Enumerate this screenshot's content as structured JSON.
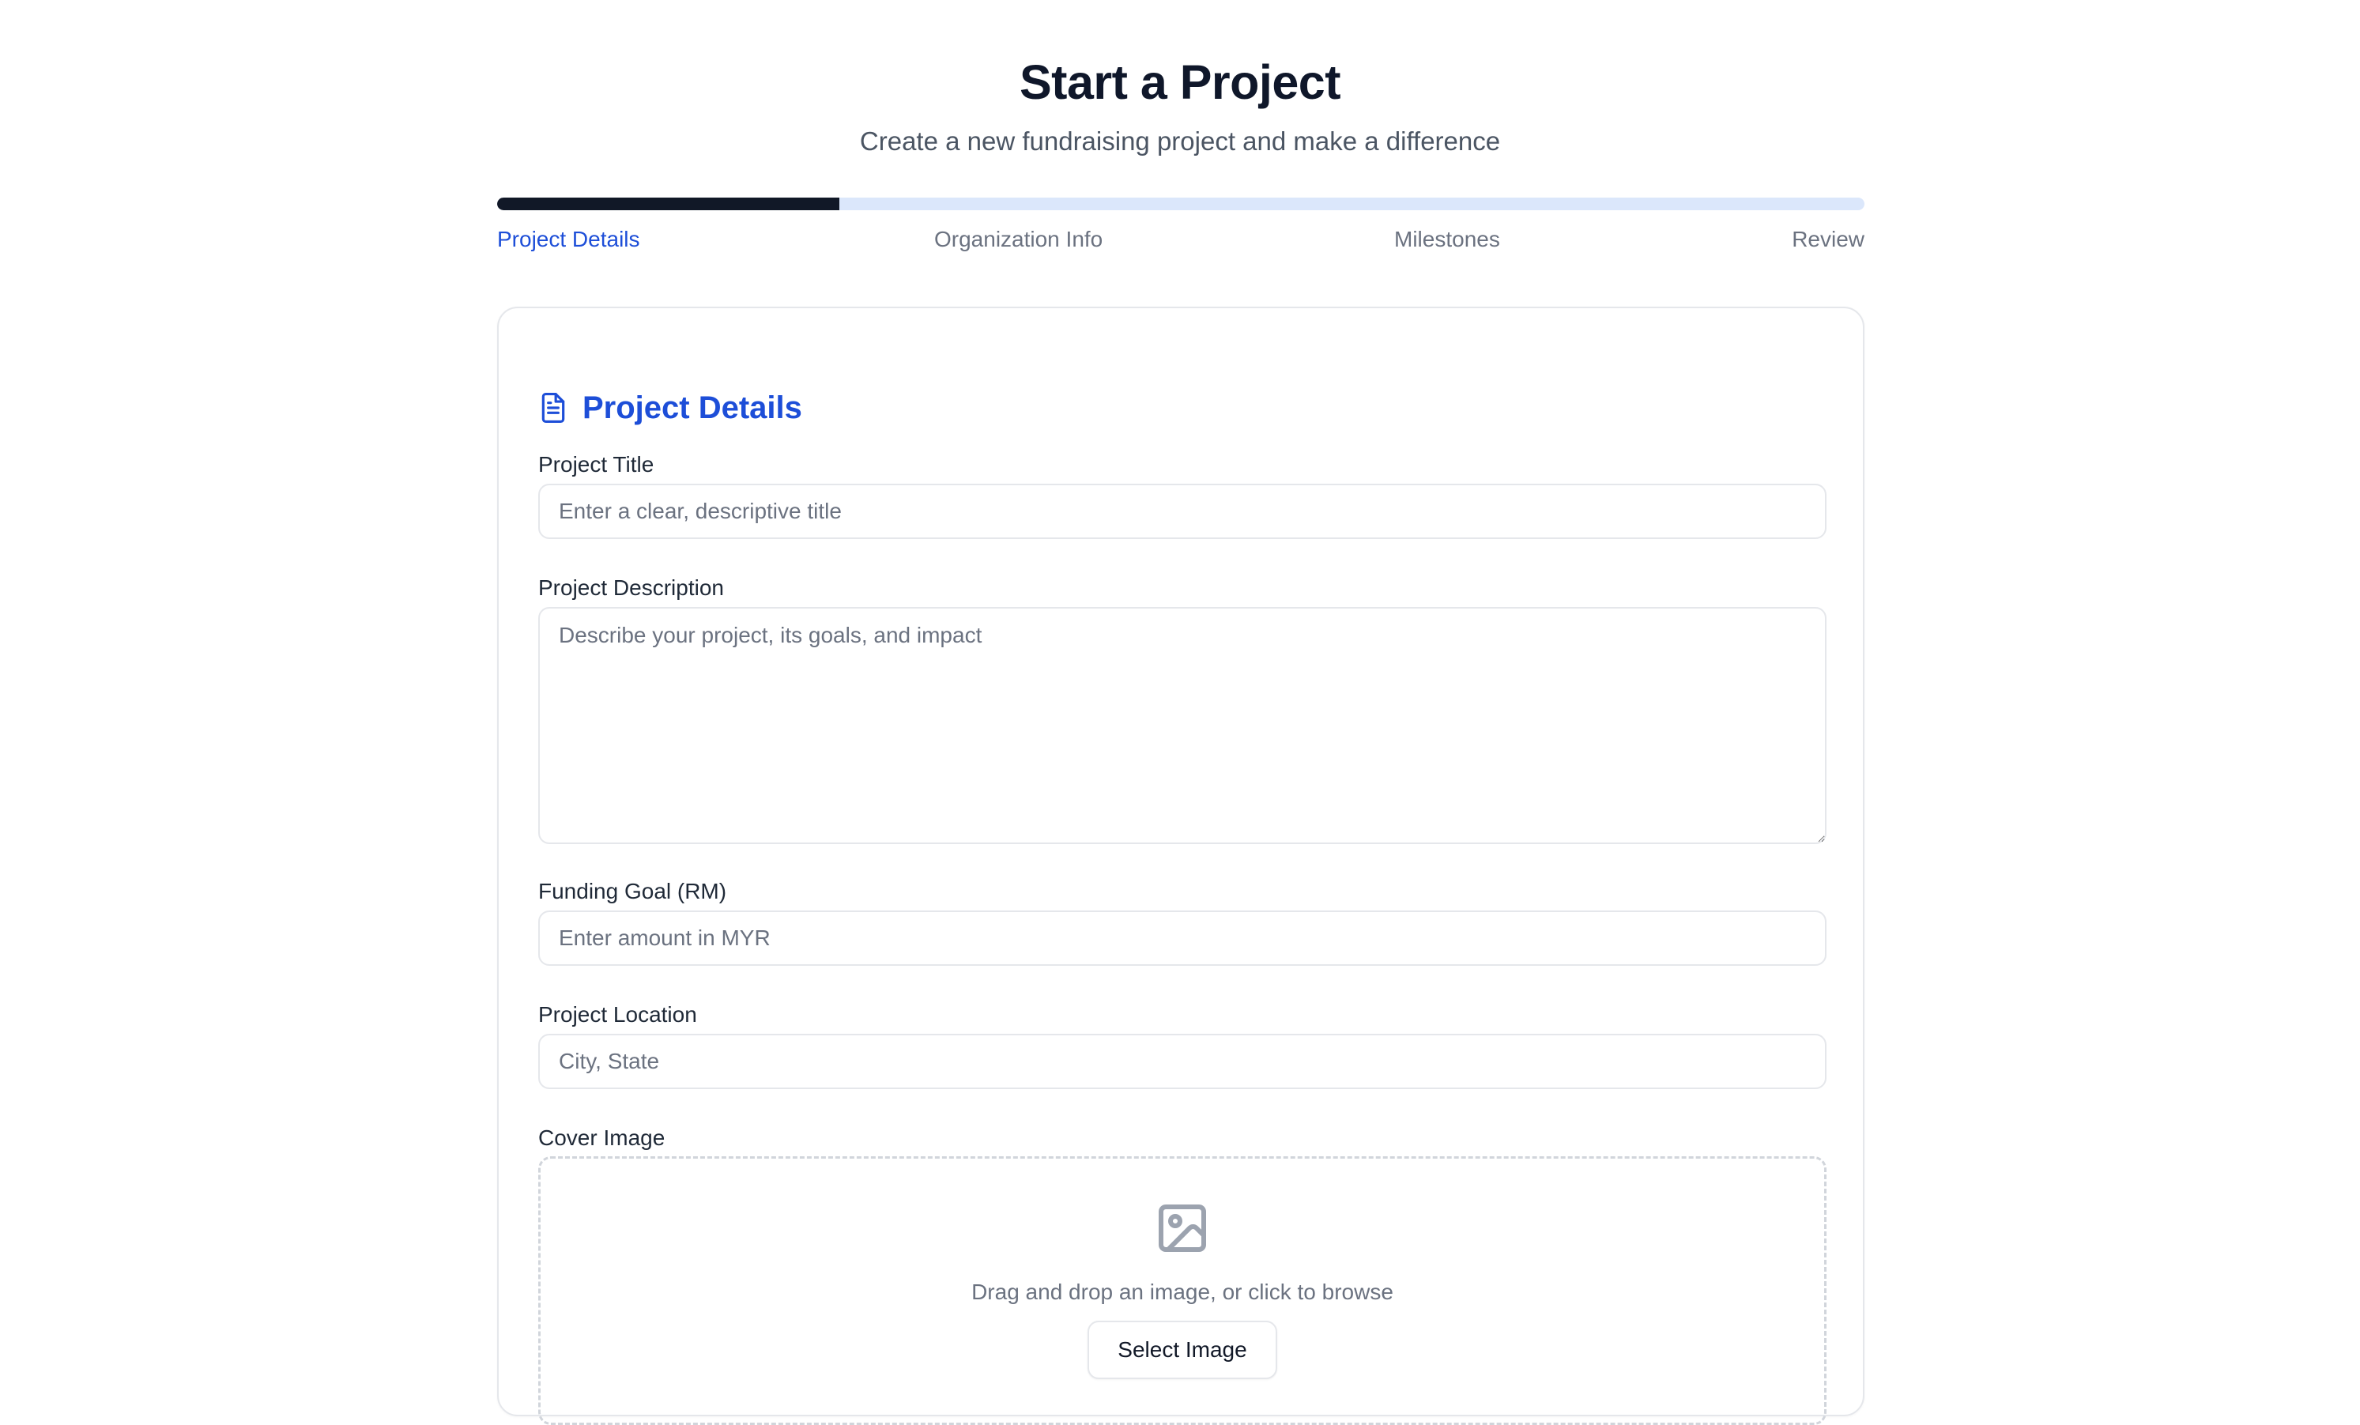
{
  "header": {
    "title": "Start a Project",
    "subtitle": "Create a new fundraising project and make a difference"
  },
  "progress": {
    "fraction": 0.25,
    "fill_color": "#111827",
    "track_color": "#dbe7fb"
  },
  "steps": [
    {
      "label": "Project Details",
      "active": true
    },
    {
      "label": "Organization Info",
      "active": false
    },
    {
      "label": "Milestones",
      "active": false
    },
    {
      "label": "Review",
      "active": false
    }
  ],
  "section": {
    "title": "Project Details",
    "icon": "file-text-icon",
    "accent_color": "#1d4ed8"
  },
  "fields": {
    "title": {
      "label": "Project Title",
      "placeholder": "Enter a clear, descriptive title",
      "value": ""
    },
    "description": {
      "label": "Project Description",
      "placeholder": "Describe your project, its goals, and impact",
      "value": ""
    },
    "goal": {
      "label": "Funding Goal (RM)",
      "placeholder": "Enter amount in MYR",
      "value": ""
    },
    "location": {
      "label": "Project Location",
      "placeholder": "City, State",
      "value": ""
    }
  },
  "cover_image": {
    "label": "Cover Image",
    "icon": "image-icon",
    "hint": "Drag and drop an image, or click to browse",
    "button_label": "Select Image"
  }
}
